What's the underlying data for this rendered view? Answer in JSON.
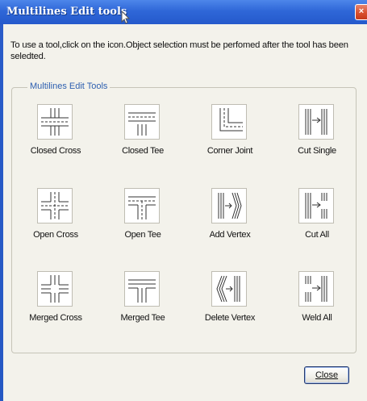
{
  "window": {
    "title": "Multilines Edit tools",
    "close_glyph": "×"
  },
  "instruction": "To use a tool,click on the icon.Object selection must be perfomed after the tool has been seledted.",
  "group": {
    "legend": "Multilines Edit Tools",
    "tools": [
      {
        "label": "Closed Cross",
        "icon": "closed-cross-icon"
      },
      {
        "label": "Closed Tee",
        "icon": "closed-tee-icon"
      },
      {
        "label": "Corner Joint",
        "icon": "corner-joint-icon"
      },
      {
        "label": "Cut Single",
        "icon": "cut-single-icon"
      },
      {
        "label": "Open Cross",
        "icon": "open-cross-icon"
      },
      {
        "label": "Open Tee",
        "icon": "open-tee-icon"
      },
      {
        "label": "Add Vertex",
        "icon": "add-vertex-icon"
      },
      {
        "label": "Cut All",
        "icon": "cut-all-icon"
      },
      {
        "label": "Merged Cross",
        "icon": "merged-cross-icon"
      },
      {
        "label": "Merged Tee",
        "icon": "merged-tee-icon"
      },
      {
        "label": "Delete Vertex",
        "icon": "delete-vertex-icon"
      },
      {
        "label": "Weld All",
        "icon": "weld-all-icon"
      }
    ]
  },
  "buttons": {
    "close": "Close"
  },
  "colors": {
    "title_bar": "#2f67d8",
    "client_bg": "#f3f2eb",
    "group_legend": "#2d5fb0",
    "close_red": "#d9502f"
  }
}
